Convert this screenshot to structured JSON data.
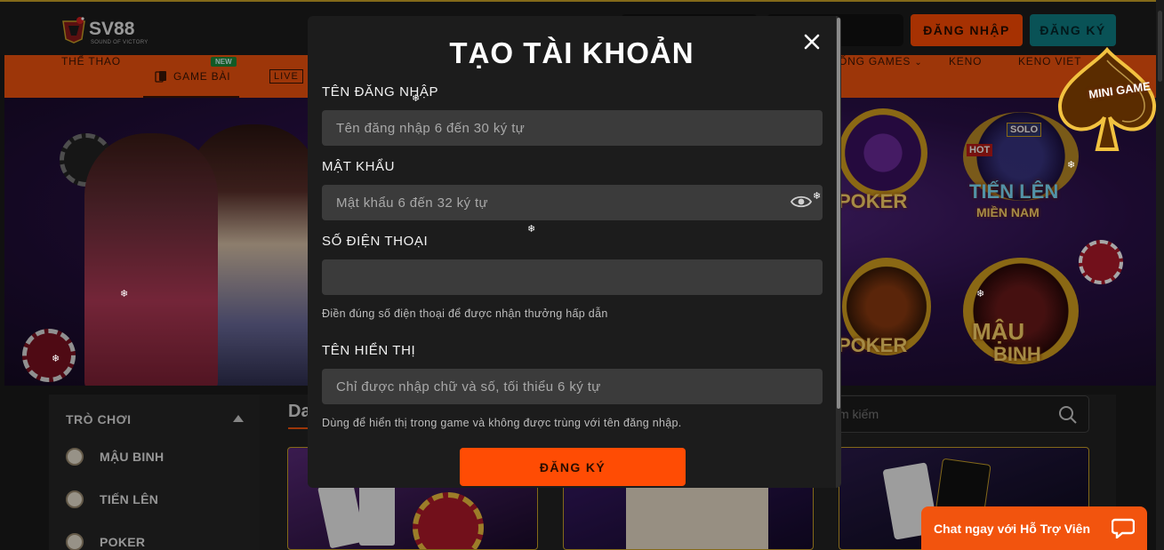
{
  "brand": {
    "name": "SV88",
    "tagline": "SOUND OF VICTORY"
  },
  "header": {
    "login_label": "ĐĂNG NHẬP",
    "register_label": "ĐĂNG KÝ"
  },
  "nav": {
    "items": [
      {
        "label": "THỂ THAO"
      },
      {
        "label": "GAME BÀI",
        "badge": "NEW",
        "active": true
      },
      {
        "label": "LIVE"
      },
      {
        "label": "ỐNG GAMES"
      },
      {
        "label": "KENO"
      },
      {
        "label": "KENO VIET"
      }
    ]
  },
  "banner": {
    "games": [
      "POKER",
      "TIẾN LÊN",
      "MIỀN NAM",
      "SOLO",
      "HOT",
      "POKER",
      "MẬU",
      "BINH"
    ],
    "minigame_label": "MINI GAME"
  },
  "sidebar": {
    "title": "TRÒ CHƠI",
    "items": [
      {
        "label": "MẬU BINH"
      },
      {
        "label": "TIẾN LÊN"
      },
      {
        "label": "POKER"
      }
    ]
  },
  "content": {
    "section_title": "Da",
    "search_placeholder": "m kiếm"
  },
  "modal": {
    "title": "TẠO TÀI KHOẢN",
    "fields": {
      "username": {
        "label": "TÊN ĐĂNG NHẬP",
        "placeholder": "Tên đăng nhập 6 đến 30 ký tự",
        "value": ""
      },
      "password": {
        "label": "MẬT KHẨU",
        "placeholder": "Mật khẩu 6 đến 32 ký tự",
        "value": ""
      },
      "phone": {
        "label": "SỐ ĐIỆN THOẠI",
        "placeholder": "",
        "value": "",
        "hint": "Điền đúng số điện thoại để được nhận thưởng hấp dẫn"
      },
      "display_name": {
        "label": "TÊN HIỂN THỊ",
        "placeholder": "Chỉ được nhập chữ và số, tối thiểu 6 ký tự",
        "value": "",
        "hint": "Dùng để hiển thị trong game và không được trùng với tên đăng nhập."
      }
    },
    "submit_label": "ĐĂNG KÝ"
  },
  "chat": {
    "label": "Chat ngay với Hỗ Trợ Viên"
  },
  "colors": {
    "accent": "#ff4c04",
    "teal": "#0f7f84",
    "modal_bg": "#1c1c1c",
    "field_bg": "#3b3b3b"
  }
}
